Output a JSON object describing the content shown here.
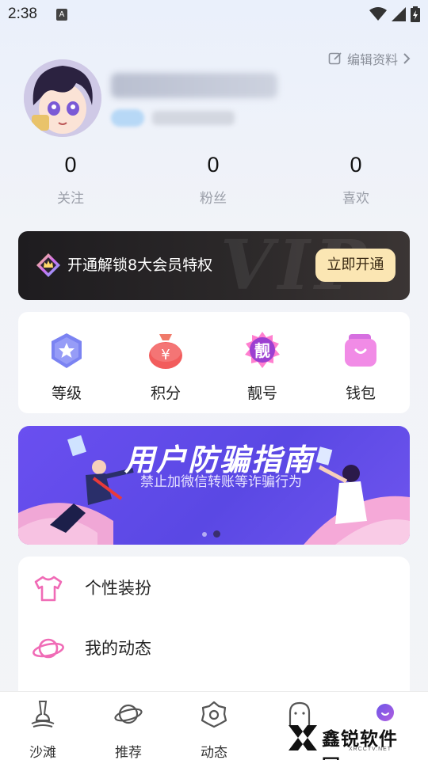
{
  "status_bar": {
    "time": "2:38",
    "notification_badge": "A",
    "icons": [
      "wifi-icon",
      "signal-icon",
      "battery-icon"
    ]
  },
  "header": {
    "edit_profile_label": "编辑资料"
  },
  "profile": {
    "avatar": "anime-boy-avatar"
  },
  "stats": [
    {
      "value": "0",
      "label": "关注"
    },
    {
      "value": "0",
      "label": "粉丝"
    },
    {
      "value": "0",
      "label": "喜欢"
    }
  ],
  "vip": {
    "watermark": "VIP",
    "text": "开通解锁8大会员特权",
    "button_label": "立即开通",
    "accent": "#fbe6b3"
  },
  "quick_menu": [
    {
      "icon": "level-star-icon",
      "label": "等级",
      "color": "#7b7ff2"
    },
    {
      "icon": "points-bag-icon",
      "label": "积分",
      "color": "#f45a5a"
    },
    {
      "icon": "pretty-number-icon",
      "label": "靓号",
      "color": "#b14dd8"
    },
    {
      "icon": "wallet-icon",
      "label": "钱包",
      "color": "#f075d8"
    }
  ],
  "banner": {
    "title": "用户防骗指南",
    "subtitle": "禁止加微信转账等诈骗行为",
    "slides": 2,
    "active_slide": 2
  },
  "menu_list": [
    {
      "icon": "shirt-icon",
      "label": "个性装扮"
    },
    {
      "icon": "planet-icon",
      "label": "我的动态"
    }
  ],
  "bottom_nav": [
    {
      "icon": "beach-icon",
      "label": "沙滩"
    },
    {
      "icon": "planet-nav-icon",
      "label": "推荐"
    },
    {
      "icon": "flower-icon",
      "label": "动态"
    },
    {
      "icon": "ghost-icon",
      "label": ""
    },
    {
      "icon": "me-avatar-icon",
      "label": ""
    }
  ],
  "watermark": {
    "brand": "鑫锐软件园",
    "site": "XRCCTV.NET"
  }
}
